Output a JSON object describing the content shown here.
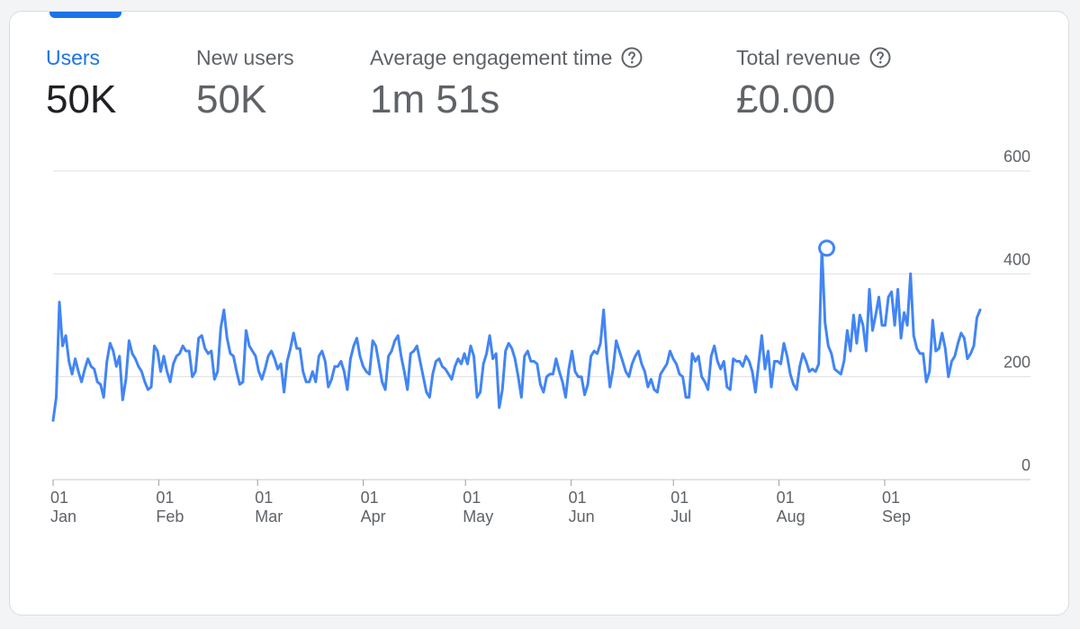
{
  "metrics": [
    {
      "label": "Users",
      "value": "50K",
      "active": true,
      "help": false
    },
    {
      "label": "New users",
      "value": "50K",
      "active": false,
      "help": false
    },
    {
      "label": "Average engagement time",
      "value": "1m 51s",
      "active": false,
      "help": true
    },
    {
      "label": "Total revenue",
      "value": "£0.00",
      "active": false,
      "help": true
    }
  ],
  "colors": {
    "accent": "#1a73e8",
    "series": "#4285f4",
    "grid": "#e0e0e0",
    "text_muted": "#5f6368",
    "text_dark": "#202124"
  },
  "chart_data": {
    "type": "line",
    "x_start": "2024-01-01",
    "x_end": "2024-09-29",
    "ylim": [
      0,
      600
    ],
    "yticks": [
      "600",
      "400",
      "200",
      "0"
    ],
    "grid": true,
    "highlight": {
      "x": "2024-08-15",
      "y": 450
    },
    "xticks": [
      {
        "day": "01",
        "month": "Jan",
        "date": "2024-01-01"
      },
      {
        "day": "01",
        "month": "Feb",
        "date": "2024-02-01"
      },
      {
        "day": "01",
        "month": "Mar",
        "date": "2024-03-01"
      },
      {
        "day": "01",
        "month": "Apr",
        "date": "2024-04-01"
      },
      {
        "day": "01",
        "month": "May",
        "date": "2024-05-01"
      },
      {
        "day": "01",
        "month": "Jun",
        "date": "2024-06-01"
      },
      {
        "day": "01",
        "month": "Jul",
        "date": "2024-07-01"
      },
      {
        "day": "01",
        "month": "Aug",
        "date": "2024-08-01"
      },
      {
        "day": "01",
        "month": "Sep",
        "date": "2024-09-01"
      }
    ],
    "series": [
      {
        "name": "",
        "values": [
          115,
          160,
          345,
          260,
          280,
          230,
          205,
          235,
          210,
          190,
          215,
          235,
          220,
          215,
          190,
          185,
          160,
          230,
          265,
          250,
          220,
          240,
          155,
          195,
          270,
          245,
          235,
          220,
          210,
          190,
          175,
          180,
          260,
          250,
          210,
          240,
          210,
          190,
          225,
          240,
          245,
          260,
          250,
          250,
          200,
          210,
          275,
          280,
          255,
          245,
          250,
          195,
          210,
          295,
          330,
          275,
          245,
          240,
          210,
          185,
          190,
          290,
          260,
          250,
          240,
          210,
          195,
          215,
          240,
          250,
          235,
          215,
          225,
          170,
          230,
          255,
          285,
          255,
          255,
          210,
          190,
          190,
          210,
          190,
          240,
          250,
          230,
          180,
          195,
          220,
          220,
          230,
          210,
          175,
          235,
          260,
          275,
          240,
          220,
          210,
          205,
          270,
          260,
          225,
          190,
          175,
          240,
          250,
          270,
          280,
          240,
          210,
          175,
          245,
          250,
          260,
          230,
          200,
          170,
          160,
          205,
          230,
          235,
          220,
          215,
          205,
          195,
          220,
          235,
          225,
          245,
          225,
          260,
          240,
          160,
          170,
          225,
          245,
          280,
          235,
          245,
          140,
          175,
          250,
          265,
          255,
          235,
          200,
          160,
          240,
          250,
          230,
          230,
          225,
          185,
          170,
          200,
          205,
          205,
          235,
          210,
          190,
          160,
          215,
          250,
          210,
          200,
          200,
          165,
          185,
          240,
          250,
          245,
          265,
          330,
          240,
          180,
          215,
          270,
          250,
          230,
          210,
          200,
          225,
          240,
          250,
          225,
          210,
          180,
          195,
          175,
          170,
          205,
          215,
          225,
          250,
          235,
          225,
          205,
          200,
          160,
          160,
          245,
          230,
          240,
          200,
          190,
          175,
          240,
          260,
          230,
          215,
          230,
          180,
          175,
          235,
          230,
          230,
          220,
          240,
          230,
          210,
          170,
          225,
          280,
          215,
          250,
          180,
          230,
          230,
          225,
          265,
          240,
          205,
          185,
          175,
          220,
          245,
          230,
          210,
          215,
          210,
          225,
          450,
          305,
          260,
          245,
          215,
          210,
          205,
          230,
          290,
          250,
          320,
          265,
          320,
          300,
          250,
          370,
          290,
          320,
          355,
          300,
          300,
          355,
          365,
          300,
          370,
          275,
          325,
          300,
          400,
          280,
          255,
          245,
          245,
          190,
          210,
          310,
          250,
          255,
          285,
          255,
          200,
          230,
          240,
          265,
          285,
          275,
          235,
          245,
          260,
          315,
          330
        ]
      }
    ]
  }
}
